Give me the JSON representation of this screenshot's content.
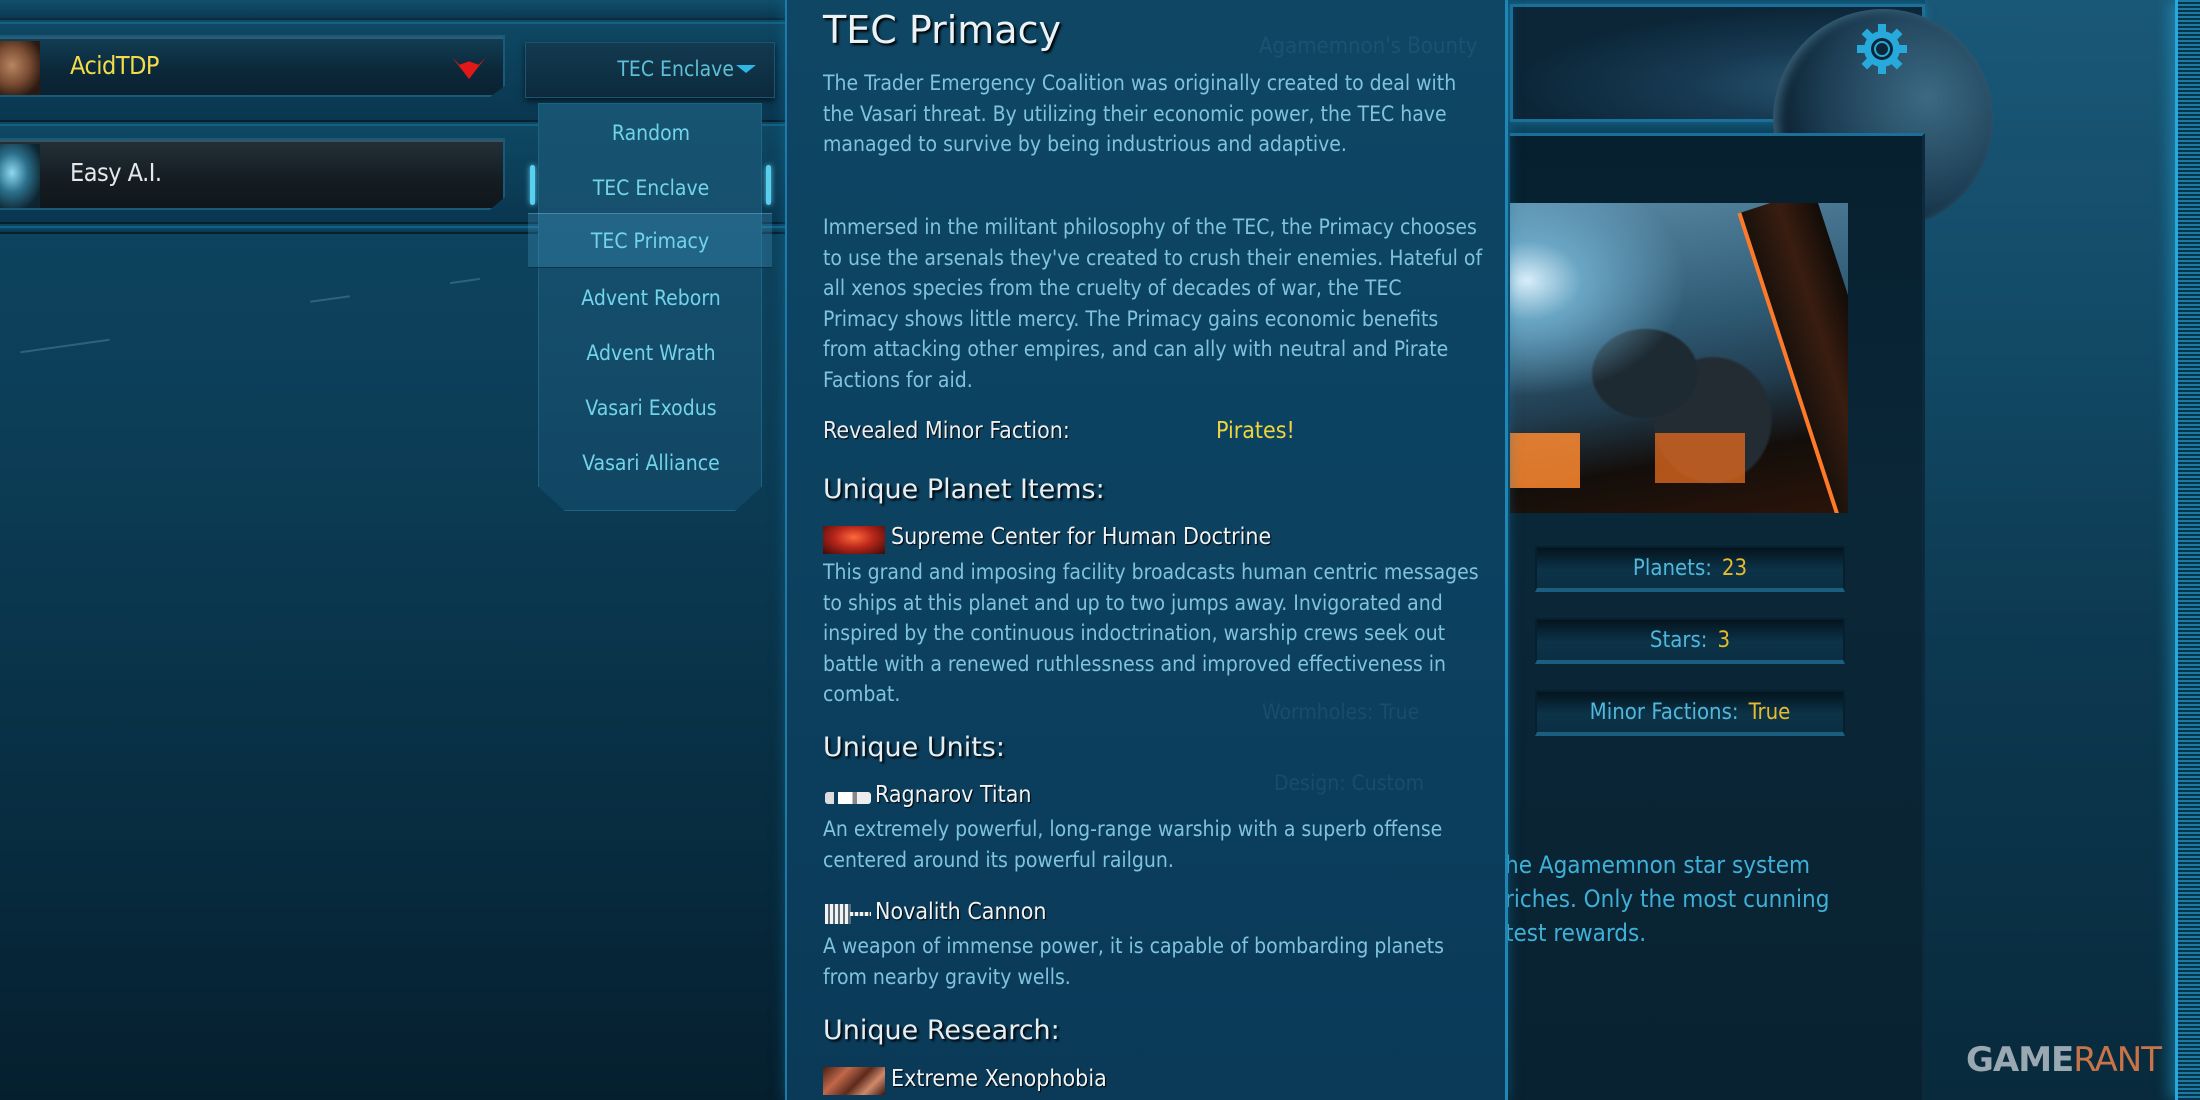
{
  "players": [
    {
      "name": "AcidTDP",
      "type": "human",
      "team_icon": "team-emblem-icon",
      "faction": "TEC Enclave"
    },
    {
      "name": "Easy A.I.",
      "type": "ai"
    }
  ],
  "faction_dropdown": {
    "selected": "TEC Enclave",
    "hovered": "TEC Primacy",
    "options": [
      "Random",
      "TEC Enclave",
      "TEC Primacy",
      "Advent Reborn",
      "Advent Wrath",
      "Vasari Exodus",
      "Vasari Alliance"
    ]
  },
  "tooltip": {
    "title": "TEC Primacy",
    "intro": "The Trader Emergency Coalition was originally created to deal with the Vasari threat. By utilizing their economic power, the TEC have managed to survive by being industrious and adaptive.",
    "description": "Immersed in the militant philosophy of the TEC, the Primacy chooses to use the arsenals they've created to crush their enemies. Hateful of all xenos species from the cruelty of decades of war, the TEC Primacy shows little mercy. The Primacy gains economic benefits from attacking other empires, and can ally with neutral and Pirate Factions for aid.",
    "minor_faction_label": "Revealed Minor Faction:",
    "minor_faction_value": "Pirates!",
    "planet_items_heading": "Unique Planet Items:",
    "planet_items": [
      {
        "name": "Supreme Center for Human Doctrine",
        "icon": "building-icon",
        "desc": "This grand and imposing facility broadcasts human centric messages to ships at this planet and up to two jumps away. Invigorated and inspired by the continuous indoctrination, warship crews seek out battle with a renewed ruthlessness and improved effectiveness in combat."
      }
    ],
    "units_heading": "Unique Units:",
    "units": [
      {
        "name": "Ragnarov Titan",
        "icon": "titan-ship-icon",
        "desc": "An extremely powerful, long-range warship with a superb offense centered around its powerful railgun."
      },
      {
        "name": "Novalith Cannon",
        "icon": "cannon-icon",
        "desc": "A weapon of immense power, it is capable of bombarding planets from nearby gravity wells."
      }
    ],
    "research_heading": "Unique Research:",
    "research": [
      {
        "name": "Extreme Xenophobia",
        "icon": "research-icon"
      }
    ]
  },
  "background_ghost_text": {
    "map_name": "Agamemnon's Bounty",
    "wormholes": "Wormholes:   True",
    "design": "Design:   Custom"
  },
  "map_panel": {
    "settings_icon": "gear-icon",
    "stats": [
      {
        "label": "Planets:",
        "value": "23"
      },
      {
        "label": "Stars:",
        "value": "3"
      },
      {
        "label": "Minor Factions:",
        "value": "True"
      }
    ],
    "description_visible": "he Agamemnon star system\nriches. Only the most cunning\ntest rewards."
  },
  "watermark": {
    "part1": "GAME",
    "part2": "RANT"
  },
  "colors": {
    "accent_cyan": "#5cc0d8",
    "human_name": "#f2dc4a",
    "stat_value": "#e6bb2e",
    "pirates": "#f0d43c",
    "team_red": "#e01818"
  }
}
